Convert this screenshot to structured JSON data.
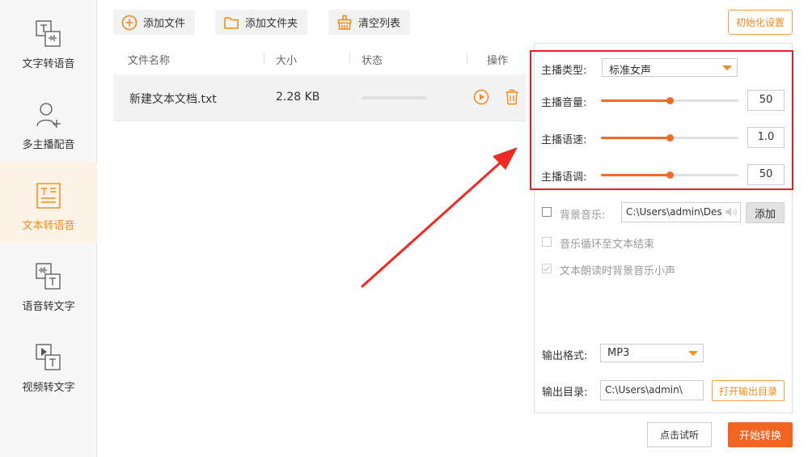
{
  "sidebar": {
    "items": [
      {
        "label": "文字转语音",
        "icon": "text-to-speech-icon"
      },
      {
        "label": "多主播配音",
        "icon": "multi-speaker-icon"
      },
      {
        "label": "文本转语音",
        "icon": "document-to-speech-icon",
        "active": true
      },
      {
        "label": "语音转文字",
        "icon": "speech-to-text-icon"
      },
      {
        "label": "视频转文字",
        "icon": "video-to-text-icon"
      }
    ]
  },
  "toolbar": {
    "add_file": "添加文件",
    "add_folder": "添加文件夹",
    "clear_list": "清空列表",
    "init_settings": "初始化设置"
  },
  "file_list": {
    "columns": [
      "文件名称",
      "大小",
      "状态",
      "操作"
    ],
    "rows": [
      {
        "name": "新建文本文档.txt",
        "size": "2.28 KB",
        "progress": 0
      }
    ]
  },
  "settings": {
    "anchor_type_label": "主播类型:",
    "anchor_type_value": "标准女声",
    "volume_label": "主播音量:",
    "volume_value": "50",
    "volume_fraction": 0.5,
    "speed_label": "主播语速:",
    "speed_value": "1.0",
    "speed_fraction": 0.5,
    "pitch_label": "主播语调:",
    "pitch_value": "50",
    "pitch_fraction": 0.5,
    "bg_music_label": "背景音乐:",
    "bg_music_path": "C:\\Users\\admin\\Des",
    "bg_music_add": "添加",
    "loop_music_label": "音乐循环至文本结束",
    "quiet_music_label": "文本朗读时背景音乐小声",
    "output_format_label": "输出格式:",
    "output_format_value": "MP3",
    "output_dir_label": "输出目录:",
    "output_dir_path": "C:\\Users\\admin\\",
    "open_output_dir": "打开输出目录"
  },
  "actions": {
    "listen": "点击试听",
    "convert": "开始转换"
  },
  "colors": {
    "accent": "#f08b1d",
    "slider": "#f06a2a",
    "convert": "#f26422",
    "highlight": "#e42020"
  }
}
